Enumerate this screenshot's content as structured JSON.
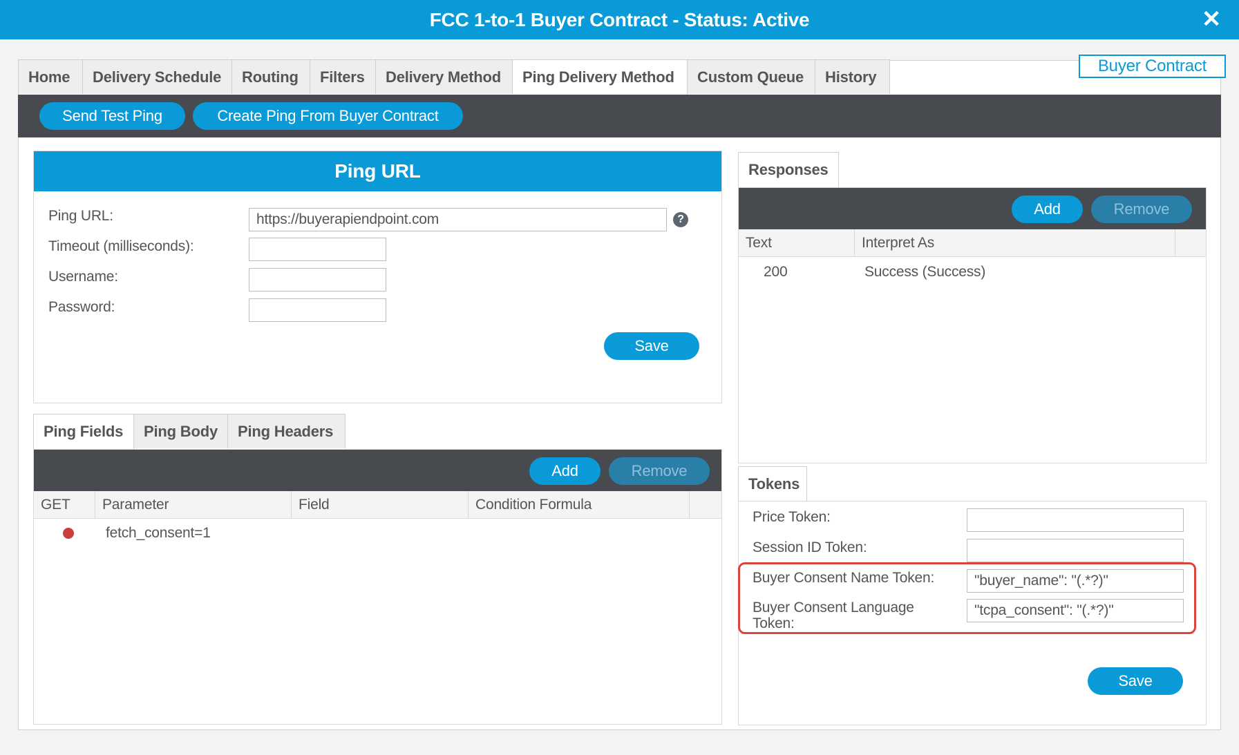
{
  "window": {
    "title": "FCC 1-to-1 Buyer Contract - Status: Active",
    "close_glyph": "✕"
  },
  "buyer_contract_link": "Buyer Contract",
  "top_tabs": [
    {
      "label": "Home"
    },
    {
      "label": "Delivery Schedule"
    },
    {
      "label": "Routing"
    },
    {
      "label": "Filters"
    },
    {
      "label": "Delivery Method"
    },
    {
      "label": "Ping Delivery Method",
      "active": true
    },
    {
      "label": "Custom Queue"
    },
    {
      "label": "History"
    }
  ],
  "toolbar": {
    "send_test_ping": "Send Test Ping",
    "create_ping": "Create Ping From Buyer Contract"
  },
  "ping_url": {
    "header": "Ping URL",
    "url_label": "Ping URL:",
    "url_value": "https://buyerapiendpoint.com",
    "timeout_label": "Timeout (milliseconds):",
    "timeout_value": "",
    "username_label": "Username:",
    "username_value": "",
    "password_label": "Password:",
    "password_value": "",
    "save": "Save",
    "help_glyph": "?"
  },
  "ping_tabs": [
    {
      "label": "Ping Fields",
      "active": true
    },
    {
      "label": "Ping Body"
    },
    {
      "label": "Ping Headers"
    }
  ],
  "ping_fields": {
    "add": "Add",
    "remove": "Remove",
    "columns": [
      "GET",
      "Parameter",
      "Field",
      "Condition Formula"
    ],
    "rows": [
      {
        "get_status": "red-dot",
        "parameter": "fetch_consent=1",
        "field": "",
        "condition": ""
      }
    ]
  },
  "responses": {
    "tab": "Responses",
    "add": "Add",
    "remove": "Remove",
    "columns": [
      "Text",
      "Interpret As"
    ],
    "rows": [
      {
        "text": "200",
        "interpret_as": "Success (Success)"
      }
    ]
  },
  "tokens": {
    "tab": "Tokens",
    "price_label": "Price Token:",
    "price_value": "",
    "session_label": "Session ID Token:",
    "session_value": "",
    "consent_name_label": "Buyer Consent Name Token:",
    "consent_name_value": "\"buyer_name\": \"(.*?)\"",
    "consent_language_label_line1": "Buyer Consent Language",
    "consent_language_label_line2": "Token:",
    "consent_language_value": "\"tcpa_consent\": \"(.*?)\"",
    "save": "Save"
  },
  "colors": {
    "accent": "#0a9ad8",
    "toolbar": "#474a4e",
    "highlight": "#d9453a",
    "status_dot": "#c9403a"
  }
}
